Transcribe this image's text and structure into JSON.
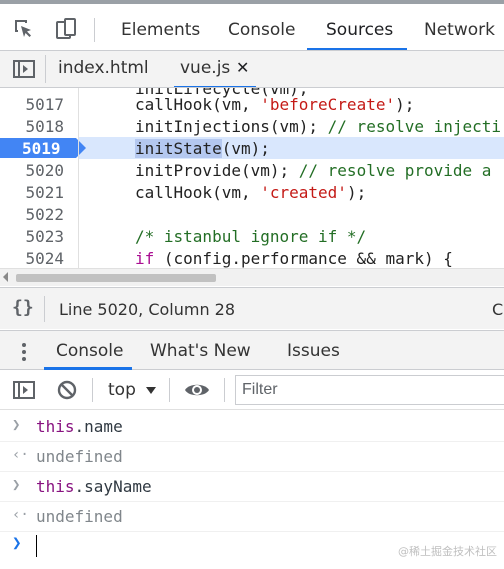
{
  "devtools_tabs": [
    "Elements",
    "Console",
    "Sources",
    "Network"
  ],
  "active_tab": "Sources",
  "file_tabs": [
    "index.html",
    "vue.js"
  ],
  "close_glyph": "✕",
  "code_lines": [
    {
      "num": "5017",
      "code": "callHook(vm, 'beforeCreate');"
    },
    {
      "num": "5018",
      "code": "initInjections(vm); // resolve injecti"
    },
    {
      "num": "5019",
      "code": "initState(vm);"
    },
    {
      "num": "5020",
      "code": "initProvide(vm); // resolve provide a"
    },
    {
      "num": "5021",
      "code": "callHook(vm, 'created');"
    },
    {
      "num": "5022",
      "code": ""
    },
    {
      "num": "5023",
      "code": "/* istanbul ignore if */"
    },
    {
      "num": "5024",
      "code": "if (config.performance && mark) {"
    }
  ],
  "status": {
    "braces": "{}",
    "position": "Line 5020, Column 28",
    "truncated": "C"
  },
  "drawer_tabs": [
    "Console",
    "What's New",
    "Issues"
  ],
  "console_toolbar": {
    "context": "top",
    "filter_placeholder": "Filter"
  },
  "console_entries": [
    {
      "kind": "input",
      "obj": "this",
      "prop": ".name"
    },
    {
      "kind": "output",
      "text": "undefined"
    },
    {
      "kind": "input",
      "obj": "this",
      "prop": ".sayName"
    },
    {
      "kind": "output",
      "text": "undefined"
    }
  ],
  "watermark": "@稀土掘金技术社区",
  "colors": {
    "accent": "#1a73e8",
    "breakpoint": "#4285f4",
    "string": "#c41a16",
    "comment": "#236e25"
  }
}
